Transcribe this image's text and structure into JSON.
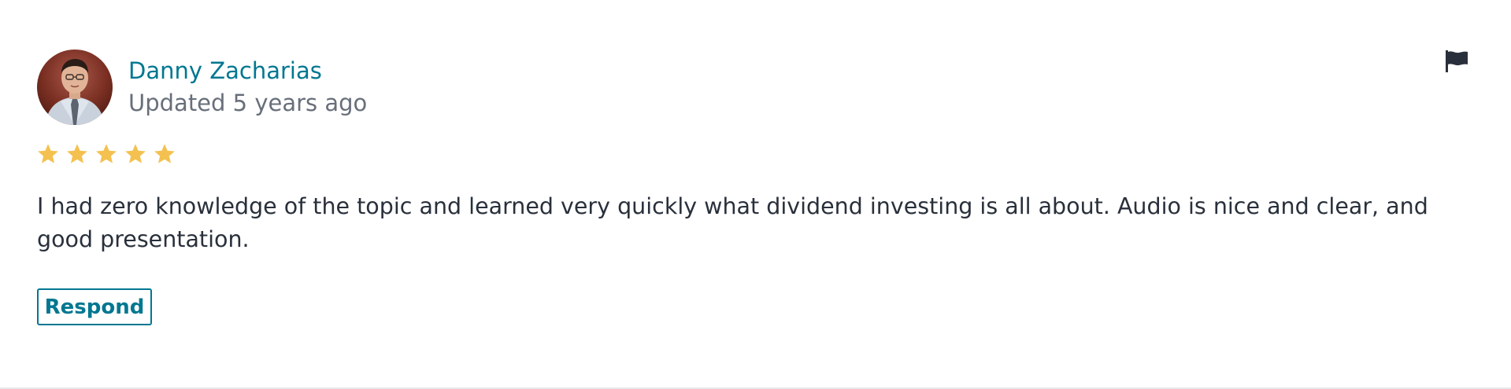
{
  "review": {
    "author": "Danny Zacharias",
    "updated": "Updated 5 years ago",
    "rating": 5,
    "rating_max": 5,
    "text": "I had zero knowledge of the topic and learned very quickly what dividend investing is all about. Audio is nice and clear, and good presentation.",
    "respond_label": "Respond"
  },
  "icons": {
    "flag": "flag-icon",
    "star": "star-icon"
  },
  "colors": {
    "link": "#007791",
    "muted": "#686f7a",
    "text": "#29303b",
    "star": "#f4c150",
    "flag": "#29303b"
  }
}
